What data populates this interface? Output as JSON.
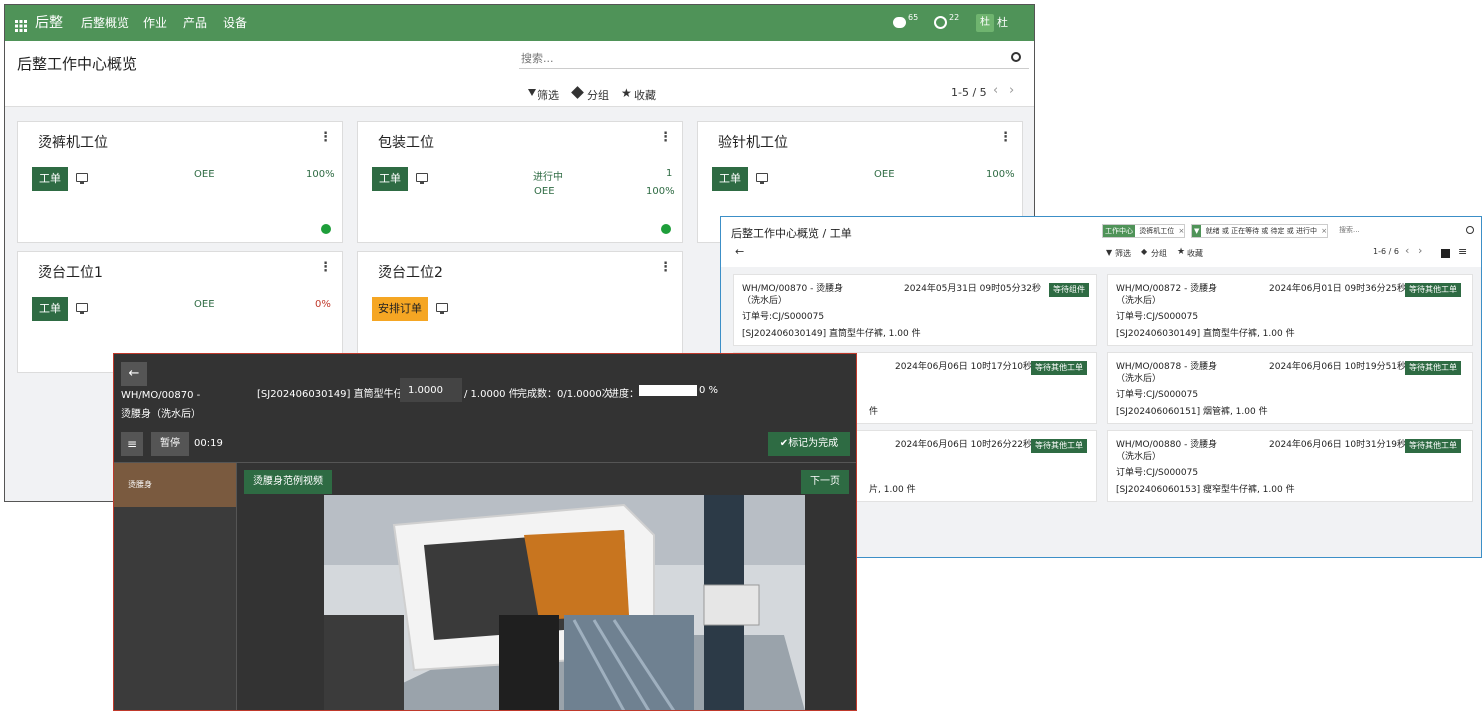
{
  "w1": {
    "app_name": "后整",
    "nav": [
      "后整概览",
      "作业",
      "产品",
      "设备"
    ],
    "chat_count": "65",
    "activity_count": "22",
    "user_initial": "杜",
    "user_name": "杜",
    "breadcrumb": "后整工作中心概览",
    "search_placeholder": "搜索...",
    "filter_label": "筛选",
    "group_label": "分组",
    "favorite_label": "收藏",
    "pager": "1-5 / 5",
    "cards": [
      {
        "title": "烫裤机工位",
        "button": "工单",
        "oee_label": "OEE",
        "oee_value": "100%"
      },
      {
        "title": "包装工位",
        "button": "工单",
        "status_label": "进行中",
        "status_count": "1",
        "oee_label": "OEE",
        "oee_value": "100%"
      },
      {
        "title": "验针机工位",
        "button": "工单",
        "oee_label": "OEE",
        "oee_value": "100%"
      },
      {
        "title": "烫台工位1",
        "button": "工单",
        "oee_label": "OEE",
        "oee_value": "0%"
      },
      {
        "title": "烫台工位2",
        "button": "安排订单"
      }
    ],
    "colors": {
      "brand": "#4f9358",
      "button": "#2e6b43",
      "danger": "#c0392b",
      "warning": "#f5a623"
    }
  },
  "w2": {
    "breadcrumb": "后整工作中心概览 / 工单",
    "facet1_label": "工作中心",
    "facet1_value": "烫裤机工位",
    "facet2_value": "就绪 或 正在等待 或 待定 或 进行中",
    "search_placeholder": "搜索...",
    "filter_label": "筛选",
    "group_label": "分组",
    "favorite_label": "收藏",
    "pager": "1-6 / 6",
    "orders": [
      {
        "name": "WH/MO/00870 - 烫腰身",
        "sub": "（洗水后）",
        "date": "2024年05月31日 09时05分32秒",
        "badge": "等待组件",
        "order_no": "订单号:CJ/S000075",
        "product": "[SJ202406030149] 直筒型牛仔裤, 1.00 件"
      },
      {
        "name": "WH/MO/00872 - 烫腰身",
        "sub": "（洗水后）",
        "date": "2024年06月01日 09时36分25秒",
        "badge": "等待其他工单",
        "order_no": "订单号:CJ/S000075",
        "product": "[SJ202406030149] 直筒型牛仔裤, 1.00 件"
      },
      {
        "name": "",
        "sub": "",
        "date": "2024年06月06日 10时17分10秒",
        "badge": "等待其他工单",
        "order_no": "",
        "product": "件"
      },
      {
        "name": "WH/MO/00878 - 烫腰身",
        "sub": "（洗水后）",
        "date": "2024年06月06日 10时19分51秒",
        "badge": "等待其他工单",
        "order_no": "订单号:CJ/S000075",
        "product": "[SJ202406060151] 烟管裤, 1.00 件"
      },
      {
        "name": "",
        "sub": "",
        "date": "2024年06月06日 10时26分22秒",
        "badge": "等待其他工单",
        "order_no": "",
        "product": "片, 1.00 件"
      },
      {
        "name": "WH/MO/00880 - 烫腰身",
        "sub": "（洗水后）",
        "date": "2024年06月06日 10时31分19秒",
        "badge": "等待其他工单",
        "order_no": "订单号:CJ/S000075",
        "product": "[SJ202406060153] 瘦窄型牛仔裤, 1.00 件"
      }
    ]
  },
  "w3": {
    "mo_line1": "WH/MO/00870 -",
    "mo_line2": "烫腰身（洗水后）",
    "product_label": "[SJ202406030149] 直筒型牛仔裤:",
    "qty_value": "1.0000",
    "qty_total": "/ 1.0000 件",
    "done_text": "完成数：0/1.0000次",
    "progress_label": "进度：",
    "progress_text": "0 %",
    "progress_value": 0,
    "pause_label": "暂停",
    "timer": "00:19",
    "mark_done_label": "标记为完成",
    "step_item": "烫腰身",
    "video_tab": "烫腰身范例视频",
    "next_label": "下一页"
  }
}
